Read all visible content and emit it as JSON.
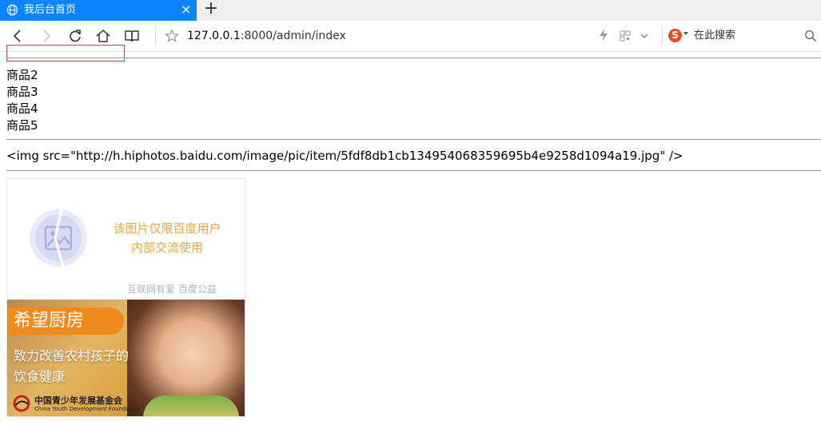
{
  "browser": {
    "tab": {
      "title": "我后台首页",
      "close": "×"
    },
    "new_tab": "+",
    "url": {
      "host": "127.0.0.1",
      "rest": ":8000/admin/index"
    },
    "search": {
      "logo": "S",
      "placeholder": "在此搜索"
    }
  },
  "page": {
    "items": [
      "商品2",
      "商品3",
      "商品4",
      "商品5"
    ],
    "img_code": "<img src=\"http://h.hiphotos.baidu.com/image/pic/item/5fdf8db1cb134954068359695b4e9258d1094a19.jpg\" />",
    "placeholder": {
      "msg_line1": "该图片仅限百度用户",
      "msg_line2": "内部交流使用",
      "footer": "互联网有爱  百度公益",
      "banner": "希望厨房",
      "slogan_line1": "致力改善农村孩子的",
      "slogan_line2": "饮食健康",
      "org_cn": "中国青少年发展基金会",
      "org_en": "China Youth Development Foundation"
    }
  },
  "colors": {
    "tab_active": "#0a84ff",
    "red_box": "#d23b3b",
    "placeholder_text": "#f0a23a"
  }
}
